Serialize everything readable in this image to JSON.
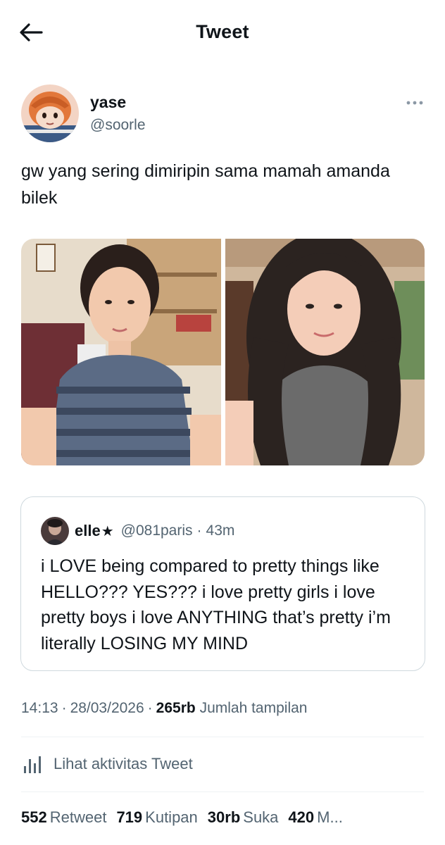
{
  "header": {
    "title": "Tweet",
    "back_icon": "arrow-left-icon"
  },
  "tweet": {
    "author_name": "yase",
    "author_handle": "@soorle",
    "text": "gw yang sering dimiripin sama mamah amanda bilek",
    "more_icon": "more-dots-icon"
  },
  "quote": {
    "name": "elle",
    "name_symbol": "★",
    "handle": "@081paris",
    "separator": "·",
    "time": "43m",
    "text": "i LOVE being compared to pretty things like HELLO??? YES??? i love pretty girls i love pretty boys i love ANYTHING that’s pretty i’m literally LOSING MY MIND"
  },
  "meta": {
    "time": "14:13",
    "separator": "·",
    "date": "28/03/2026",
    "views_count": "265rb",
    "views_label": "Jumlah tampilan"
  },
  "activity": {
    "label": "Lihat aktivitas Tweet",
    "icon": "analytics-bars-icon"
  },
  "stats": {
    "retweets_count": "552",
    "retweets_label": "Retweet",
    "quotes_count": "719",
    "quotes_label": "Kutipan",
    "likes_count": "30rb",
    "likes_label": "Suka",
    "bookmarks_count": "420",
    "bookmarks_label": "M..."
  },
  "colors": {
    "text_primary": "#0f1419",
    "text_secondary": "#536471",
    "border": "#cfd9de",
    "divider": "#eff3f4"
  }
}
